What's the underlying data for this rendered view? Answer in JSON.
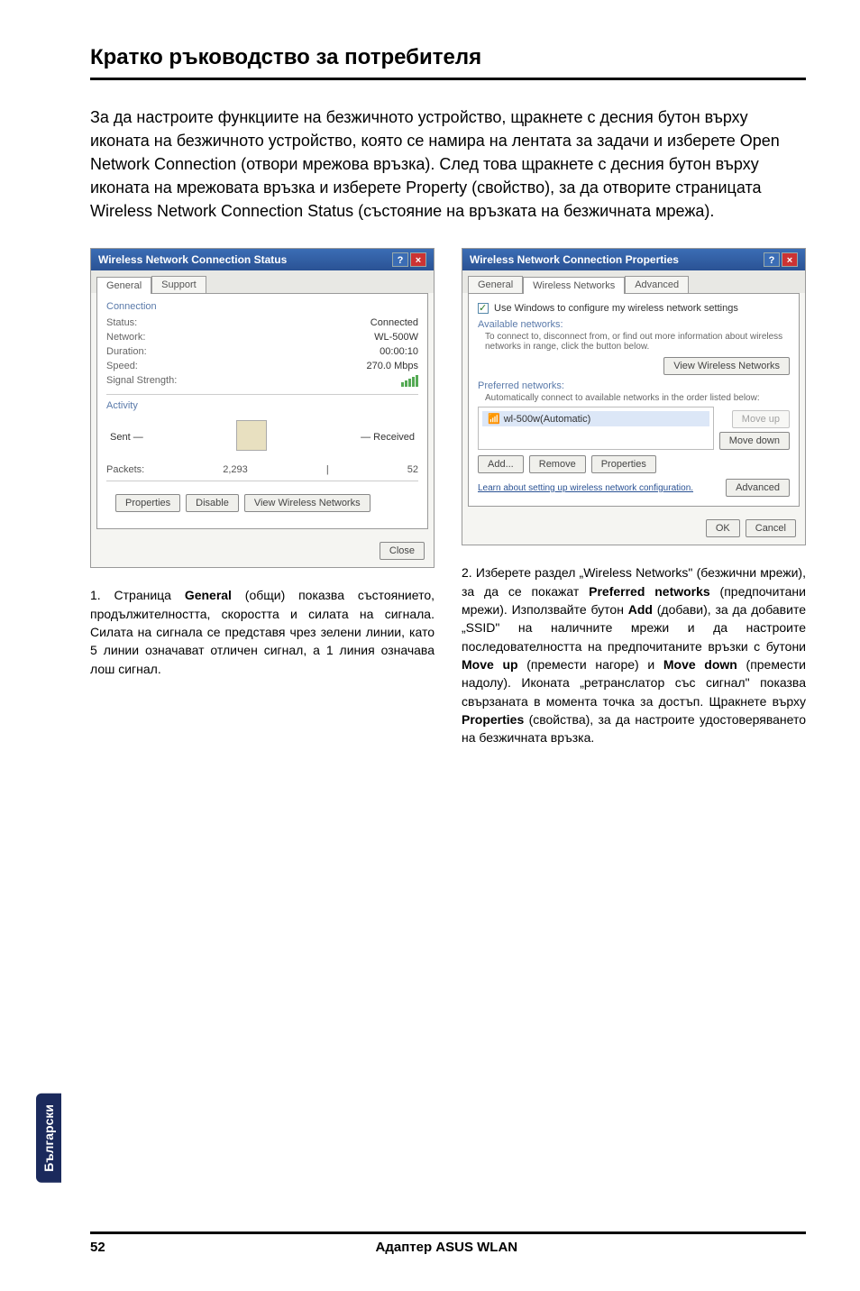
{
  "header": {
    "title": "Кратко ръководство за потребителя"
  },
  "intro": "За да настроите функциите на безжичното устройство, щракнете с десния бутон върху иконата на безжичното устройство, която се намира на лентата за задачи и изберете Open Network Connection (отвори мрежова връзка). След това щракнете с десния бутон върху иконата на мрежовата връзка и изберете Property (свойство), за да отворите страницата Wireless Network Connection Status (състояние на връзката на безжичната мрежа).",
  "left": {
    "win_title": "Wireless Network Connection Status",
    "tabs": {
      "general": "General",
      "support": "Support"
    },
    "group_conn": "Connection",
    "status_label": "Status:",
    "status_val": "Connected",
    "network_label": "Network:",
    "network_val": "WL-500W",
    "duration_label": "Duration:",
    "duration_val": "00:00:10",
    "speed_label": "Speed:",
    "speed_val": "270.0 Mbps",
    "signal_label": "Signal Strength:",
    "group_act": "Activity",
    "sent": "Sent",
    "received": "Received",
    "packets_label": "Packets:",
    "packets_sent": "2,293",
    "packets_recv": "52",
    "btn_properties": "Properties",
    "btn_disable": "Disable",
    "btn_view": "View Wireless Networks",
    "btn_close": "Close",
    "caption_num": "1. ",
    "caption_a": "Страница ",
    "caption_b": "General",
    "caption_c": " (общи) показва състоянието, продължителността, скоростта и силата на сигнала. Силата на сигнала се представя чрез зелени линии, като 5 линии означават отличен сигнал, а 1 линия означава лош сигнал."
  },
  "right": {
    "win_title": "Wireless Network Connection Properties",
    "tabs": {
      "general": "General",
      "wireless": "Wireless Networks",
      "advanced": "Advanced"
    },
    "use_windows": "Use Windows to configure my wireless network settings",
    "available_label": "Available networks:",
    "available_text": "To connect to, disconnect from, or find out more information about wireless networks in range, click the button below.",
    "btn_view": "View Wireless Networks",
    "preferred_label": "Preferred networks:",
    "preferred_text": "Automatically connect to available networks in the order listed below:",
    "net_item": "wl-500w(Automatic)",
    "btn_moveup": "Move up",
    "btn_movedown": "Move down",
    "btn_add": "Add...",
    "btn_remove": "Remove",
    "btn_props": "Properties",
    "learn": "Learn about setting up wireless network configuration.",
    "btn_adv": "Advanced",
    "btn_ok": "OK",
    "btn_cancel": "Cancel",
    "caption_num": "2. ",
    "caption_a": "Изберете раздел „Wireless Networks\" (безжични мрежи), за да се покажат ",
    "caption_b": "Preferred networks",
    "caption_c": " (предпочитани мрежи). Използвайте бутон ",
    "caption_d": "Add",
    "caption_e": " (добави), за да добавите „SSID\" на наличните мрежи и да настроите последователността на предпочитаните връзки с бутони ",
    "caption_f": "Move up",
    "caption_g": " (премести нагоре) и ",
    "caption_h": "Move down",
    "caption_i": " (премести надолу). Иконата „ретранслатор със сигнал\" показва свързаната в момента точка за достъп. Щракнете върху ",
    "caption_j": "Properties",
    "caption_k": " (свойства), за да настроите удостоверяването на безжичната връзка."
  },
  "side_tab": "Български",
  "footer": {
    "page": "52",
    "title": "Адаптер ASUS WLAN"
  }
}
